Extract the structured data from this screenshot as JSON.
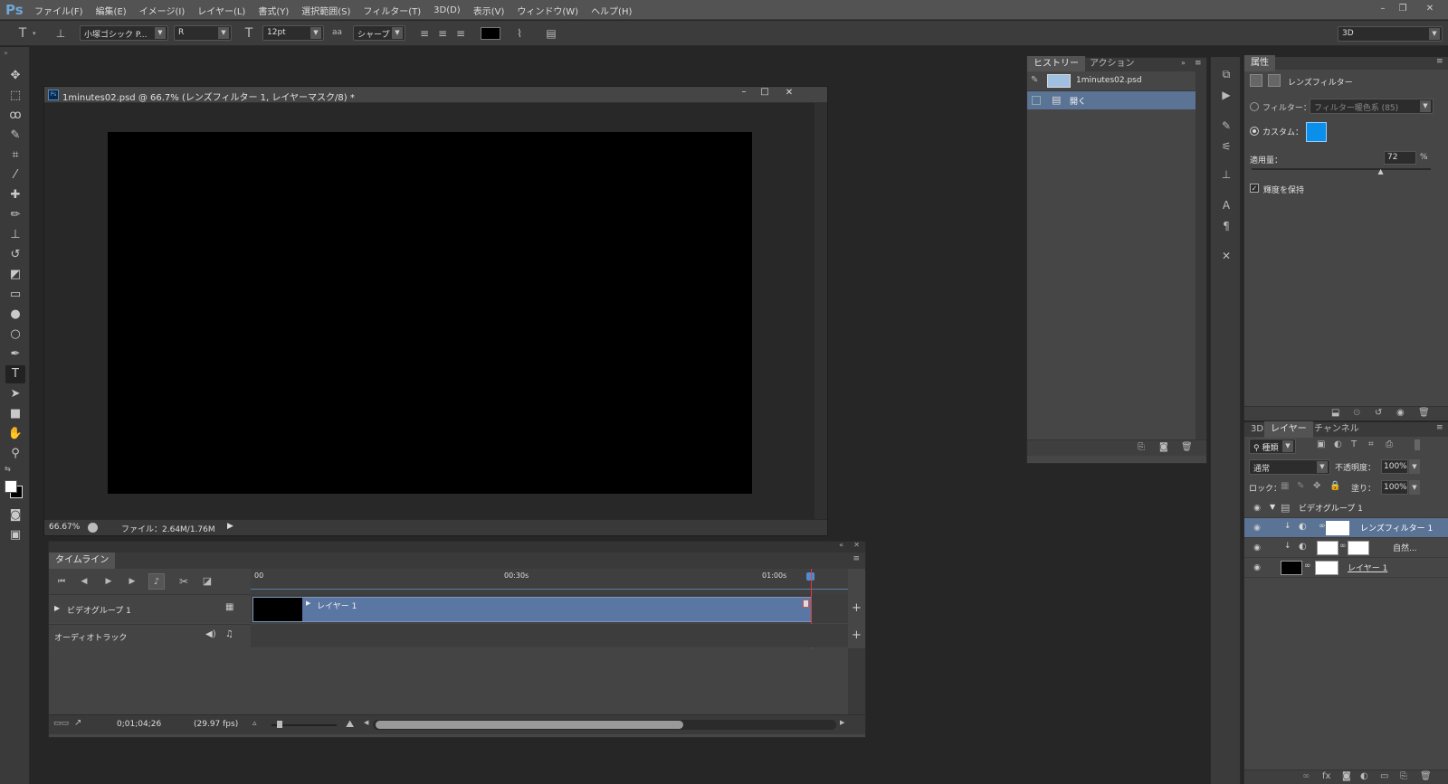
{
  "app": {
    "logo": "Ps"
  },
  "menu": [
    "ファイル(F)",
    "編集(E)",
    "イメージ(I)",
    "レイヤー(L)",
    "書式(Y)",
    "選択範囲(S)",
    "フィルター(T)",
    "3D(D)",
    "表示(V)",
    "ウィンドウ(W)",
    "ヘルプ(H)"
  ],
  "options": {
    "font_family": "小塚ゴシック P...",
    "font_style": "R",
    "font_size": "12pt",
    "aa": "aa",
    "antialias": "シャープ",
    "workspace": "3D",
    "text_color": "#000000"
  },
  "document": {
    "title": "1minutes02.psd @ 66.7% (レンズフィルター 1, レイヤーマスク/8) *",
    "zoom": "66.67%",
    "file_info": "ファイル：2.64M/1.76M"
  },
  "timeline": {
    "tab": "タイムライン",
    "ruler": [
      "00",
      "00:30s",
      "01:00s"
    ],
    "tracks": [
      {
        "name": "ビデオグループ 1",
        "clip": "レイヤー 1"
      },
      {
        "name": "オーディオトラック"
      }
    ],
    "timecode": "0;01;04;26",
    "fps": "(29.97 fps)"
  },
  "history": {
    "tabs": [
      "ヒストリー",
      "アクション"
    ],
    "items": [
      {
        "label": "1minutes02.psd",
        "type": "snapshot"
      },
      {
        "label": "開く",
        "type": "step"
      }
    ]
  },
  "properties": {
    "tab": "属性",
    "title": "レンズフィルター",
    "filter_label": "フィルター：",
    "filter_value": "フィルター暖色系 (85)",
    "custom_label": "カスタム：",
    "custom_color": "#0a8fea",
    "density_label": "適用量：",
    "density_value": "72",
    "density_unit": "%",
    "density_level": 0.72,
    "preserve_label": "輝度を保持"
  },
  "layers": {
    "tabs": [
      "3D",
      "レイヤー",
      "チャンネル"
    ],
    "filter": "種類",
    "blend": "通常",
    "opacity_label": "不透明度：",
    "opacity": "100%",
    "lock_label": "ロック：",
    "fill_label": "塗り：",
    "fill": "100%",
    "items": [
      {
        "name": "ビデオグループ 1",
        "type": "group"
      },
      {
        "name": "レンズフィルター 1",
        "type": "adjustment",
        "selected": true
      },
      {
        "name": "自然...",
        "type": "adjustment"
      },
      {
        "name": "レイヤー 1",
        "type": "layer"
      }
    ]
  }
}
